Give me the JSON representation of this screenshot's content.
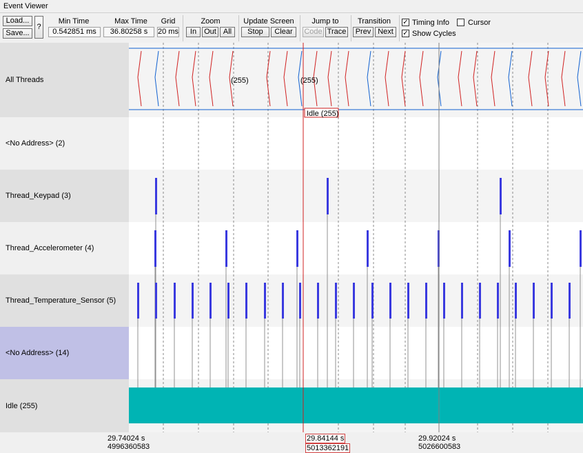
{
  "window": {
    "title": "Event Viewer"
  },
  "toolbar": {
    "load_label": "Load...",
    "save_label": "Save...",
    "help_label": "?",
    "min_time": {
      "label": "Min Time",
      "value": "0.542851 ms"
    },
    "max_time": {
      "label": "Max Time",
      "value": "36.80258 s"
    },
    "grid": {
      "label": "Grid",
      "value": "20 ms"
    },
    "zoom": {
      "label": "Zoom",
      "in": "In",
      "out": "Out",
      "all": "All"
    },
    "update": {
      "label": "Update Screen",
      "stop": "Stop",
      "clear": "Clear"
    },
    "jump": {
      "label": "Jump to",
      "code": "Code",
      "trace": "Trace"
    },
    "transition": {
      "label": "Transition",
      "prev": "Prev",
      "next": "Next"
    },
    "timing_info": {
      "label": "Timing Info",
      "checked": true
    },
    "cursor": {
      "label": "Cursor",
      "checked": false
    },
    "show_cycles": {
      "label": "Show Cycles",
      "checked": true
    }
  },
  "rows": [
    {
      "label": "All Threads"
    },
    {
      "label": "<No Address> (2)"
    },
    {
      "label": "Thread_Keypad (3)"
    },
    {
      "label": "Thread_Accelerometer (4)"
    },
    {
      "label": "Thread_Temperature_Sensor (5)"
    },
    {
      "label": "<No Address> (14)"
    },
    {
      "label": "Idle (255)"
    }
  ],
  "plot": {
    "all_threads_tags": [
      "(255)",
      "(255)"
    ],
    "hover_tag": "Idle (255)",
    "colors": {
      "bar": "#3a3adf",
      "idle": "#00b4b4",
      "cursor": "#d02020",
      "switch_red": "#d02020",
      "switch_blue": "#1060d0",
      "selected_row": "#c0c0e6"
    }
  },
  "axis": {
    "left": {
      "time": "29.74024 s",
      "cycles": "4996360583"
    },
    "cursor": {
      "time": "29.84144 s",
      "cycles": "5013362191"
    },
    "right": {
      "time": "29.92024 s",
      "cycles": "5026600583"
    }
  }
}
